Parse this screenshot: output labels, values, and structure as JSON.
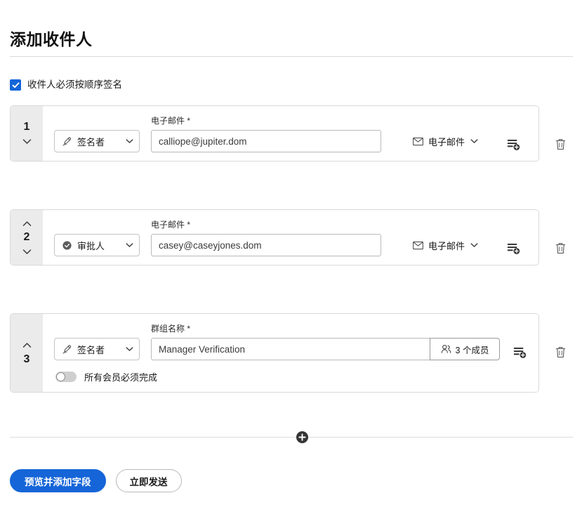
{
  "header": {
    "title": "添加收件人"
  },
  "sequential": {
    "label": "收件人必须按顺序签名",
    "checked": true,
    "accent_color": "#1565d8"
  },
  "recipients": [
    {
      "number": "1",
      "show_up": false,
      "show_down": true,
      "role": {
        "label": "签名者",
        "icon": "pen-icon"
      },
      "field": {
        "label": "电子邮件",
        "required_mark": "*",
        "value": "calliope@jupiter.dom",
        "type": "email"
      },
      "delivery": {
        "label": "电子邮件",
        "icon": "envelope-icon"
      },
      "customize_icon": "add-form-fields-icon",
      "delete_icon": "trash-icon"
    },
    {
      "number": "2",
      "show_up": true,
      "show_down": true,
      "role": {
        "label": "审批人",
        "icon": "check-circle-icon"
      },
      "field": {
        "label": "电子邮件",
        "required_mark": "*",
        "value": "casey@caseyjones.dom",
        "type": "email"
      },
      "delivery": {
        "label": "电子邮件",
        "icon": "envelope-icon"
      },
      "customize_icon": "add-form-fields-icon",
      "delete_icon": "trash-icon"
    },
    {
      "number": "3",
      "show_up": true,
      "show_down": false,
      "role": {
        "label": "签名者",
        "icon": "pen-icon"
      },
      "field": {
        "label": "群组名称",
        "required_mark": "*",
        "value": "Manager Verification",
        "type": "group"
      },
      "members": {
        "label": "3 个成员",
        "icon": "members-icon"
      },
      "toggle": {
        "label": "所有会员必须完成",
        "on": false
      },
      "customize_icon": "add-form-fields-icon",
      "delete_icon": "trash-icon"
    }
  ],
  "add_recipient": {
    "icon": "plus-circle-icon",
    "tooltip": ""
  },
  "footer": {
    "primary_label": "预览并添加字段",
    "secondary_label": "立即发送",
    "primary_color": "#1565d8"
  }
}
